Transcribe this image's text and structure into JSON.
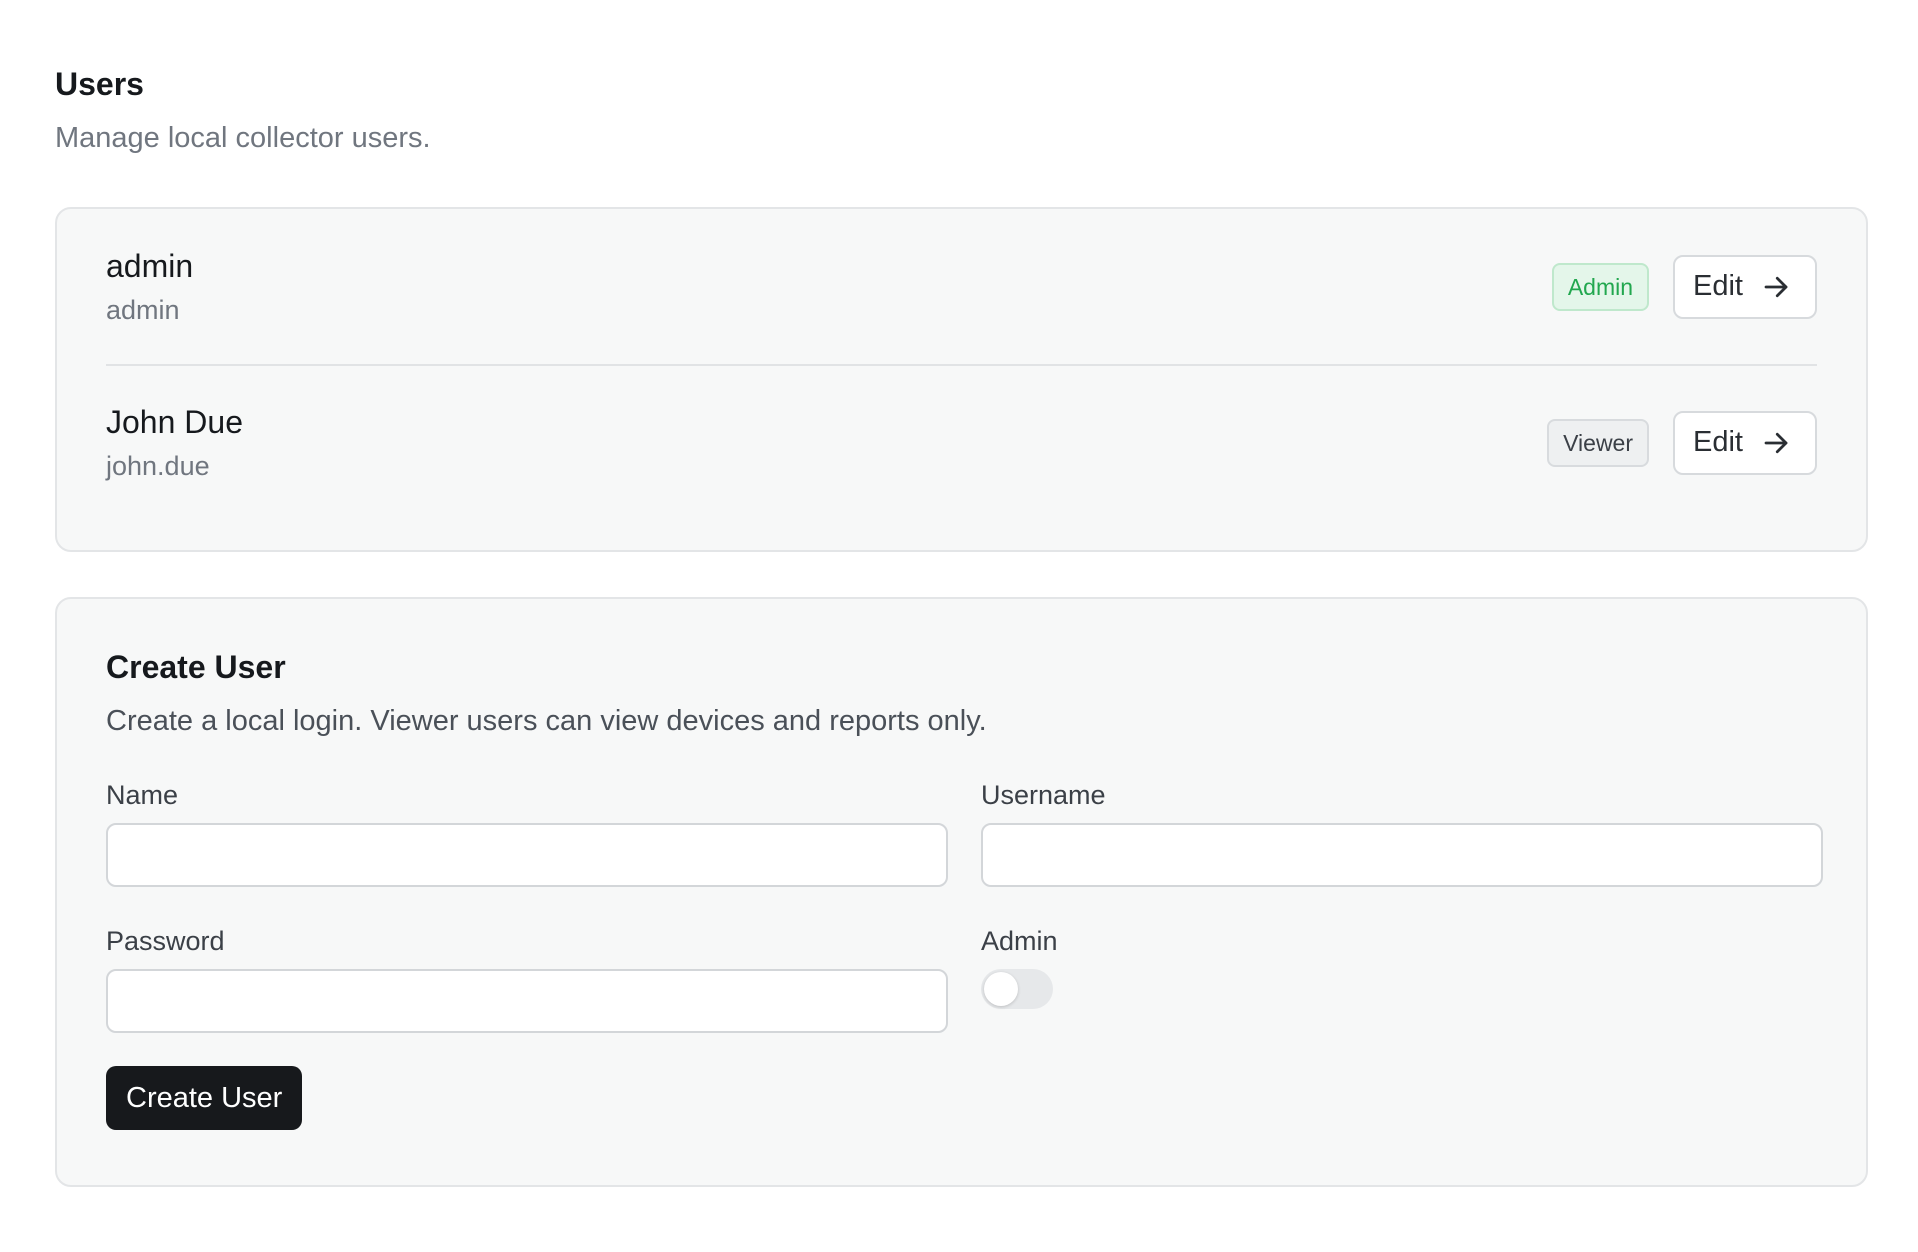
{
  "header": {
    "title": "Users",
    "subtitle": "Manage local collector users."
  },
  "users": [
    {
      "name": "admin",
      "username": "admin",
      "role": "Admin",
      "edit_label": "Edit"
    },
    {
      "name": "John Due",
      "username": "john.due",
      "role": "Viewer",
      "edit_label": "Edit"
    }
  ],
  "create_form": {
    "title": "Create User",
    "description": "Create a local login. Viewer users can view devices and reports only.",
    "name_label": "Name",
    "name_value": "",
    "username_label": "Username",
    "username_value": "",
    "password_label": "Password",
    "password_value": "",
    "admin_label": "Admin",
    "admin_enabled": false,
    "submit_label": "Create User"
  },
  "colors": {
    "admin_badge": "#22a74f",
    "viewer_badge": "#3b4047",
    "primary_button": "#17191c",
    "card_background": "#f7f8f8"
  },
  "icons": {
    "edit_arrow": "arrow-right-icon"
  }
}
